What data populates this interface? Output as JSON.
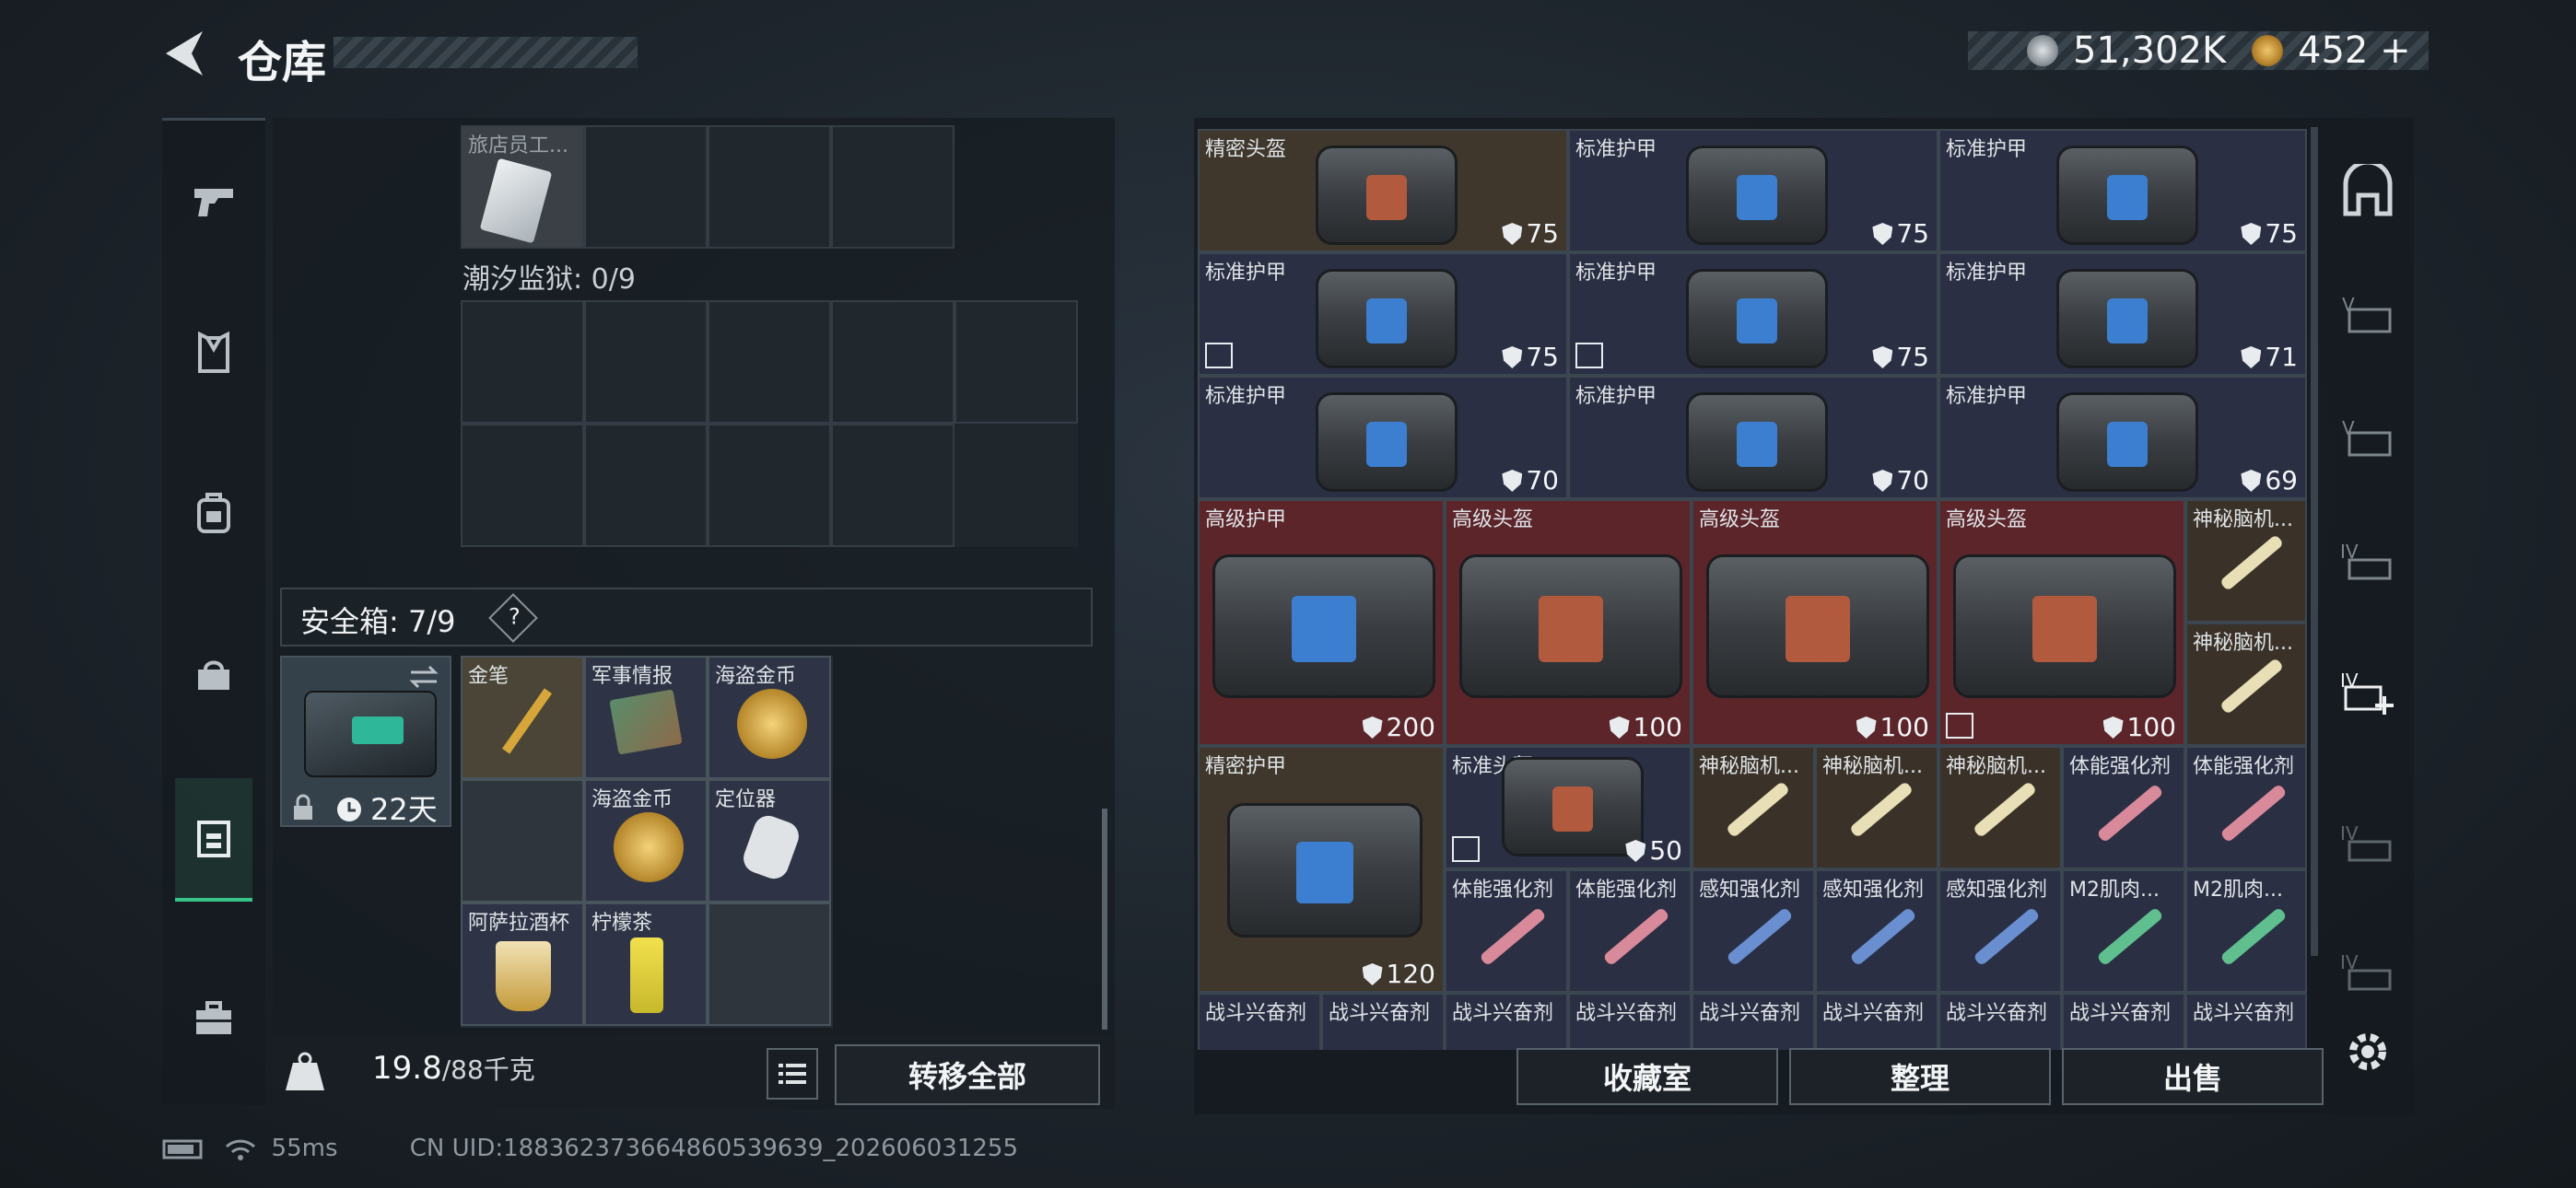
{
  "header": {
    "title": "仓库",
    "silver_amount": "51,302K",
    "gold_amount": "452",
    "gold_add": "+"
  },
  "left_nav": {
    "items": [
      "pistol-icon",
      "vest-icon",
      "backpack-icon",
      "pouch-icon",
      "safe-box-icon",
      "briefcase-icon"
    ]
  },
  "stash": {
    "top_item_name": "旅店员工...",
    "prison_label": "潮汐监狱: 0/9"
  },
  "safe_box": {
    "label": "安全箱: 7/9",
    "help": "?",
    "days": "22天",
    "items": [
      {
        "name": "金笔"
      },
      {
        "name": "军事情报"
      },
      {
        "name": "海盗金币"
      },
      {
        "name": "海盗金币"
      },
      {
        "name": "定位器"
      },
      {
        "name": "阿萨拉酒杯"
      },
      {
        "name": "柠檬茶"
      }
    ]
  },
  "weight": {
    "current": "19.8",
    "max": "/88千克"
  },
  "buttons": {
    "transfer_all": "转移全部",
    "collection": "收藏室",
    "organize": "整理",
    "sell": "出售"
  },
  "inventory": [
    {
      "name": "精密头盔",
      "durability": "75"
    },
    {
      "name": "标准护甲",
      "durability": "75"
    },
    {
      "name": "标准护甲",
      "durability": "75"
    },
    {
      "name": "标准护甲",
      "durability": "75"
    },
    {
      "name": "标准护甲",
      "durability": "75"
    },
    {
      "name": "标准护甲",
      "durability": "71"
    },
    {
      "name": "标准护甲",
      "durability": "70"
    },
    {
      "name": "标准护甲",
      "durability": "70"
    },
    {
      "name": "标准护甲",
      "durability": "69"
    },
    {
      "name": "高级护甲",
      "durability": "200"
    },
    {
      "name": "高级头盔",
      "durability": "100"
    },
    {
      "name": "高级头盔",
      "durability": "100"
    },
    {
      "name": "高级头盔",
      "durability": "100"
    },
    {
      "name": "神秘脑机..."
    },
    {
      "name": "神秘脑机..."
    },
    {
      "name": "精密护甲",
      "durability": "120"
    },
    {
      "name": "标准头盔",
      "durability": "50"
    },
    {
      "name": "神秘脑机..."
    },
    {
      "name": "神秘脑机..."
    },
    {
      "name": "神秘脑机..."
    },
    {
      "name": "体能强化剂"
    },
    {
      "name": "体能强化剂"
    },
    {
      "name": "体能强化剂"
    },
    {
      "name": "体能强化剂"
    },
    {
      "name": "感知强化剂"
    },
    {
      "name": "感知强化剂"
    },
    {
      "name": "感知强化剂"
    },
    {
      "name": "M2肌肉..."
    },
    {
      "name": "M2肌肉..."
    },
    {
      "name": "战斗兴奋剂"
    }
  ],
  "status": {
    "ping": "55ms",
    "uid": "CN UID:1883623736648605396​39_202606031255"
  }
}
